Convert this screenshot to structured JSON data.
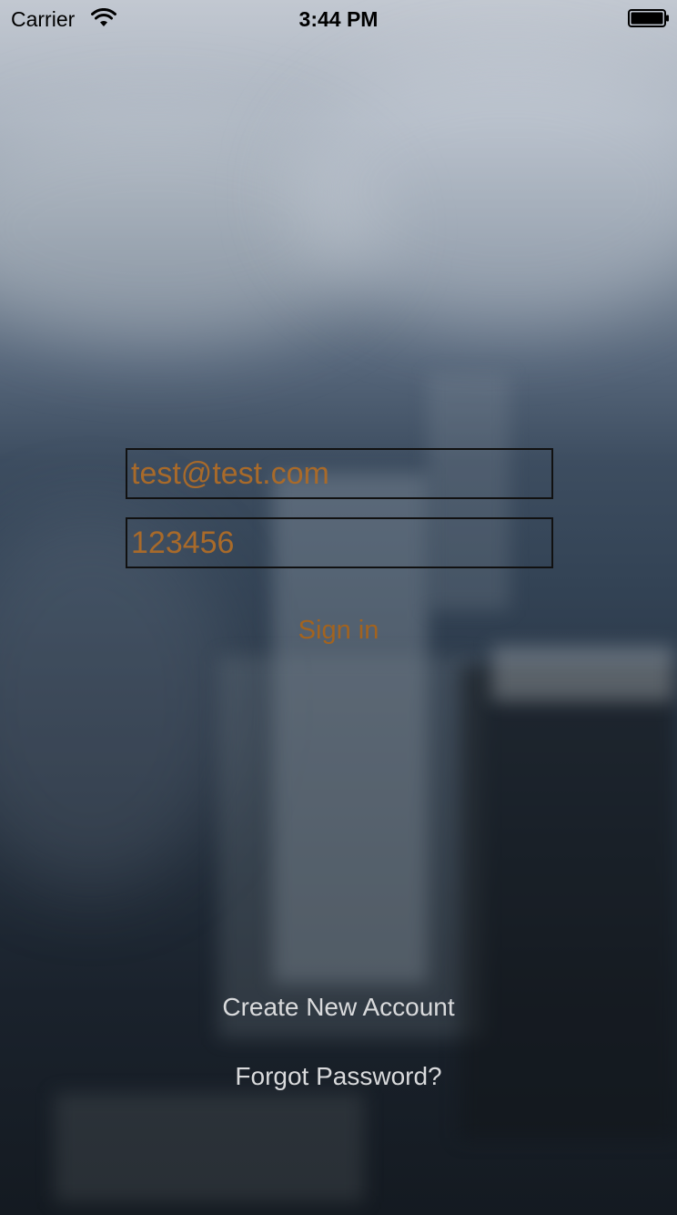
{
  "status_bar": {
    "carrier": "Carrier",
    "time": "3:44 PM",
    "wifi_icon": "wifi-icon",
    "battery_icon": "battery-icon"
  },
  "login": {
    "email_value": "test@test.com",
    "password_value": "123456",
    "sign_in_label": "Sign in"
  },
  "links": {
    "create_account": "Create New Account",
    "forgot_password": "Forgot Password?"
  },
  "colors": {
    "accent": "#a2631f",
    "link_text": "#d9dadc"
  }
}
